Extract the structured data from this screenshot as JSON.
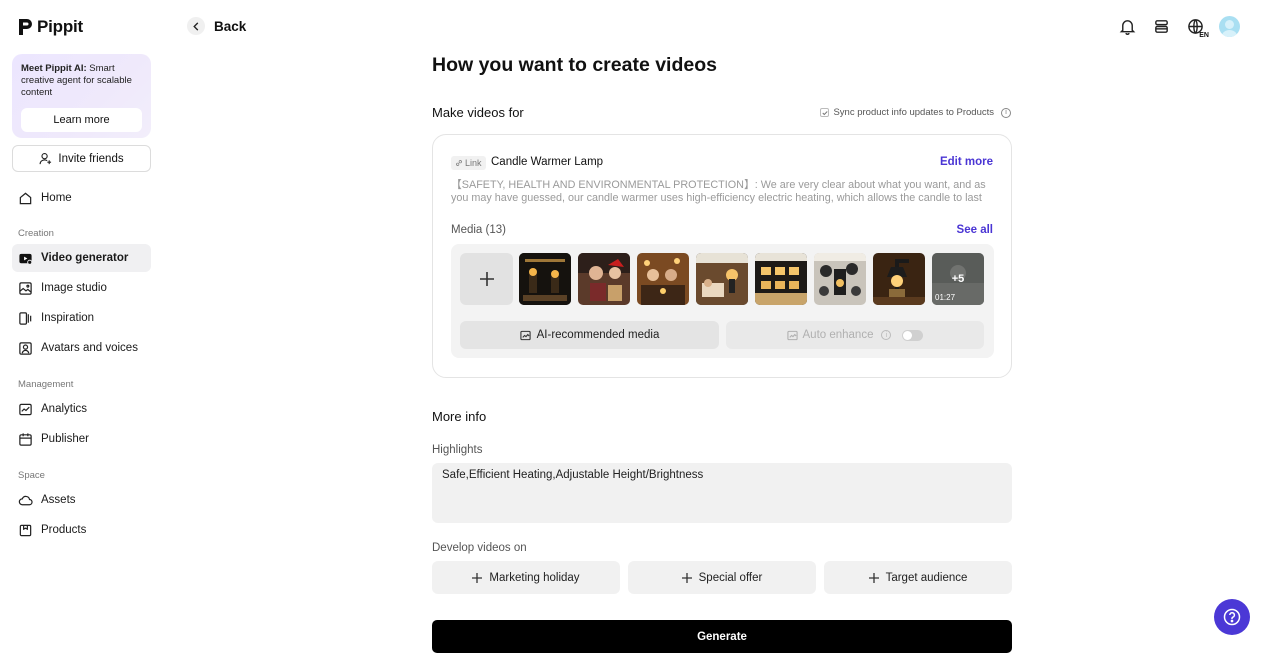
{
  "app": {
    "name": "Pippit"
  },
  "promo": {
    "title": "Meet Pippit AI:",
    "text": " Smart creative agent for scalable content",
    "button": "Learn more"
  },
  "sidebar": {
    "invite": "Invite friends",
    "home": "Home",
    "sections": {
      "creation": "Creation",
      "management": "Management",
      "space": "Space"
    },
    "creation_items": [
      "Video generator",
      "Image studio",
      "Inspiration",
      "Avatars and voices"
    ],
    "management_items": [
      "Analytics",
      "Publisher"
    ],
    "space_items": [
      "Assets",
      "Products"
    ],
    "active": "Video generator"
  },
  "topbar": {
    "back": "Back",
    "lang_code": "EN"
  },
  "main": {
    "title": "How you want to create videos",
    "make_for": "Make videos for",
    "sync": "Sync product info updates to Products",
    "card": {
      "link_tag": "Link",
      "product": "Candle Warmer Lamp",
      "edit_more": "Edit more",
      "description": "【SAFETY, HEALTH AND ENVIRONMENTAL PROTECTION】: We are very clear about what you want, and as you may have guessed, our candle warmer uses high-efficiency electric heating, which allows the candle to last longer",
      "media_label": "Media (13)",
      "see_all": "See all",
      "more_count": "+5",
      "duration": "01:27",
      "ai_media": "AI-recommended media",
      "auto_enhance": "Auto enhance"
    },
    "more_info": "More info",
    "highlights_label": "Highlights",
    "highlights_value": "Safe,Efficient Heating,Adjustable Height/Brightness",
    "develop_label": "Develop videos on",
    "options": [
      "Marketing holiday",
      "Special offer",
      "Target audience"
    ],
    "generate": "Generate"
  },
  "colors": {
    "accent": "#4a35d4",
    "fab": "#4b38d6",
    "promo_bg": "#ece6ff"
  },
  "icons": {
    "nav": [
      "home-icon",
      "video-icon",
      "image-icon",
      "inspiration-icon",
      "avatar-icon",
      "analytics-icon",
      "calendar-icon",
      "cloud-icon",
      "box-icon"
    ],
    "top": [
      "bell-icon",
      "layers-icon",
      "globe-icon",
      "avatar"
    ]
  }
}
